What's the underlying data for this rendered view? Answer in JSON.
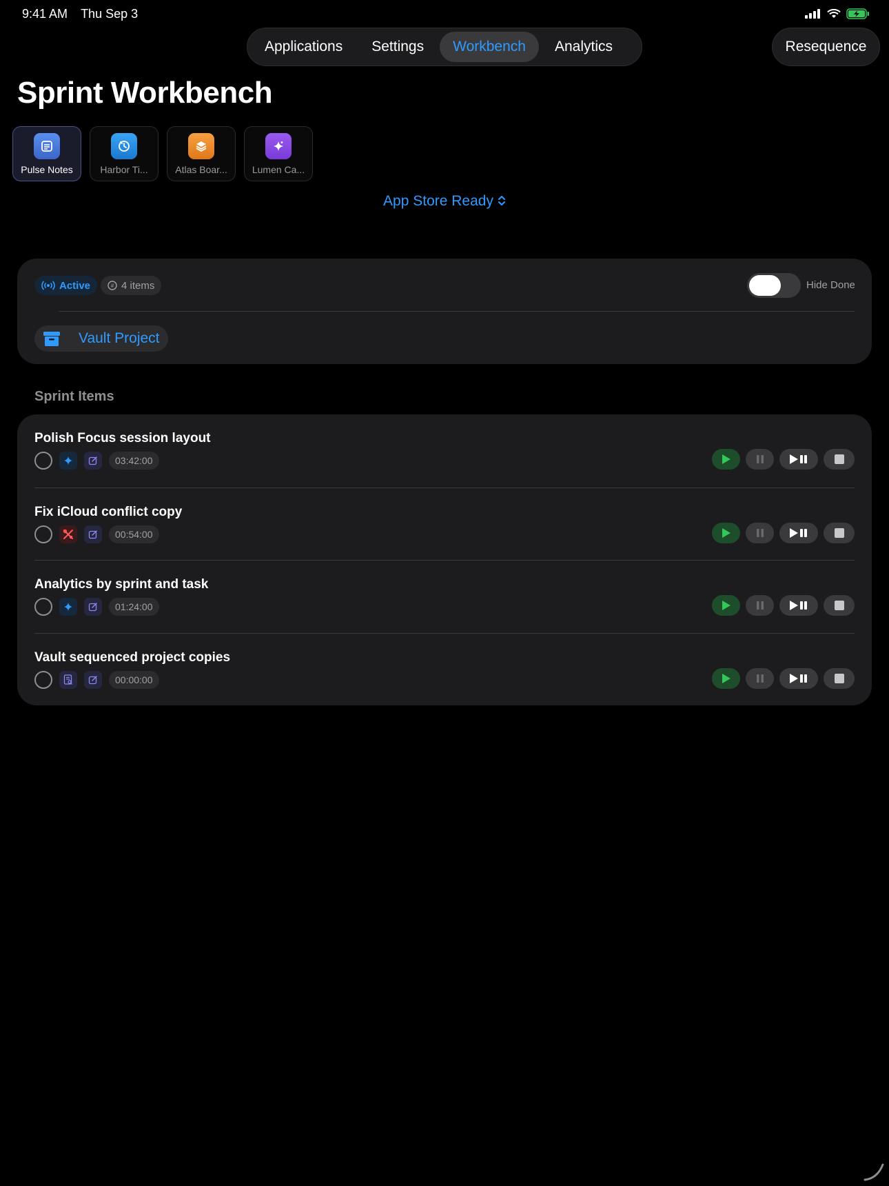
{
  "status_bar": {
    "time": "9:41 AM",
    "date": "Thu Sep 3"
  },
  "nav": {
    "tabs": [
      {
        "label": "Applications"
      },
      {
        "label": "Settings"
      },
      {
        "label": "Workbench"
      },
      {
        "label": "Analytics"
      }
    ],
    "active_tab": "Workbench",
    "resequence_label": "Resequence"
  },
  "page_title": "Sprint Workbench",
  "apps": [
    {
      "label": "Pulse Notes",
      "icon": "note-icon",
      "color": "#4a7bd8",
      "selected": true
    },
    {
      "label": "Harbor Ti...",
      "icon": "timer-icon",
      "color": "#2a8fe0",
      "selected": false
    },
    {
      "label": "Atlas Boar...",
      "icon": "layers-icon",
      "color": "#f08a2a",
      "selected": false
    },
    {
      "label": "Lumen Ca...",
      "icon": "sparkle-icon",
      "color": "#8a4ae0",
      "selected": false
    }
  ],
  "stage_picker": {
    "label": "App Store Ready",
    "icon": "chevron-up-down-icon"
  },
  "filter_card": {
    "active_label": "Active",
    "count_label": "4 items",
    "hide_done_label": "Hide Done",
    "hide_done_on": false,
    "project_label": "Vault Project"
  },
  "section_title": "Sprint Items",
  "tasks": [
    {
      "title": "Polish Focus session layout",
      "category_icon": "sparkle-icon",
      "category_color": "blue",
      "time": "03:42:00"
    },
    {
      "title": "Fix iCloud conflict copy",
      "category_icon": "tools-icon",
      "category_color": "red",
      "time": "00:54:00"
    },
    {
      "title": "Analytics by sprint and task",
      "category_icon": "sparkle-icon",
      "category_color": "blue",
      "time": "01:24:00"
    },
    {
      "title": "Vault sequenced project copies",
      "category_icon": "doc-search-icon",
      "category_color": "purple",
      "time": "00:00:00"
    }
  ],
  "colors": {
    "accent": "#2f9bff",
    "play_green": "#34c759",
    "background": "#000000",
    "card": "#1c1c1e"
  }
}
